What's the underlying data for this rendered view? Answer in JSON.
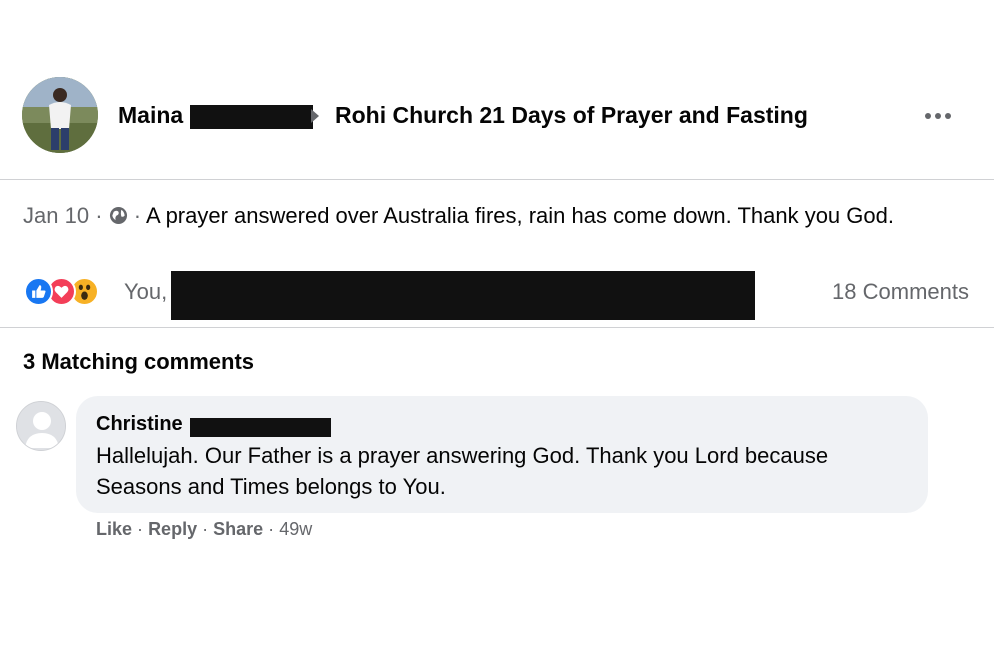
{
  "post": {
    "author_name": "Maina",
    "group_name": "Rohi Church 21 Days of Prayer and Fasting",
    "date": "Jan 10",
    "separator": "·",
    "text": "A prayer answered over Australia fires, rain has come down. Thank you God.",
    "privacy_icon": "globe-icon"
  },
  "reactions": {
    "icons": [
      "like-icon",
      "love-icon",
      "wow-icon"
    ],
    "names": "You,",
    "comments_count": "18 Comments"
  },
  "comments_section": {
    "title": "3 Matching comments",
    "comments": [
      {
        "author": "Christine",
        "text": "Hallelujah. Our Father is a prayer answering God. Thank you Lord because Seasons and Times belongs to You.",
        "like": "Like",
        "reply": "Reply",
        "share": "Share",
        "time": "49w"
      }
    ]
  },
  "colors": {
    "link_gray": "#65676b",
    "like_blue": "#1877f2",
    "love_red": "#f33e58",
    "wow_yellow": "#f7b125",
    "bubble": "#f0f2f5"
  }
}
